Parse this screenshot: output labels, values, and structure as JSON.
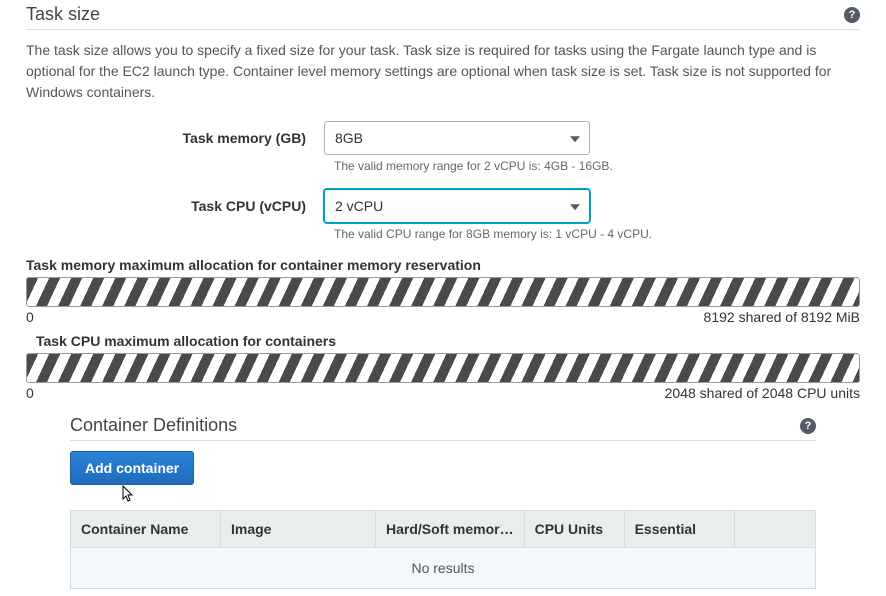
{
  "task_size": {
    "section_title": "Task size",
    "description": "The task size allows you to specify a fixed size for your task. Task size is required for tasks using the Fargate launch type and is optional for the EC2 launch type. Container level memory settings are optional when task size is set. Task size is not supported for Windows containers.",
    "memory_label": "Task memory (GB)",
    "memory_value": "8GB",
    "memory_hint": "The valid memory range for 2 vCPU is: 4GB - 16GB.",
    "cpu_label": "Task CPU (vCPU)",
    "cpu_value": "2 vCPU",
    "cpu_hint": "The valid CPU range for 8GB memory is: 1 vCPU - 4 vCPU.",
    "mem_alloc_label": "Task memory maximum allocation for container memory reservation",
    "mem_alloc_min": "0",
    "mem_alloc_status": "8192 shared of 8192 MiB",
    "cpu_alloc_label": "Task CPU maximum allocation for containers",
    "cpu_alloc_min": "0",
    "cpu_alloc_status": "2048 shared of 2048 CPU units"
  },
  "container_defs": {
    "section_title": "Container Definitions",
    "add_button": "Add container",
    "columns": {
      "name": "Container Name",
      "image": "Image",
      "memory": "Hard/Soft memor…",
      "cpu": "CPU Units",
      "essential": "Essential"
    },
    "empty": "No results"
  },
  "icons": {
    "help": "?"
  }
}
